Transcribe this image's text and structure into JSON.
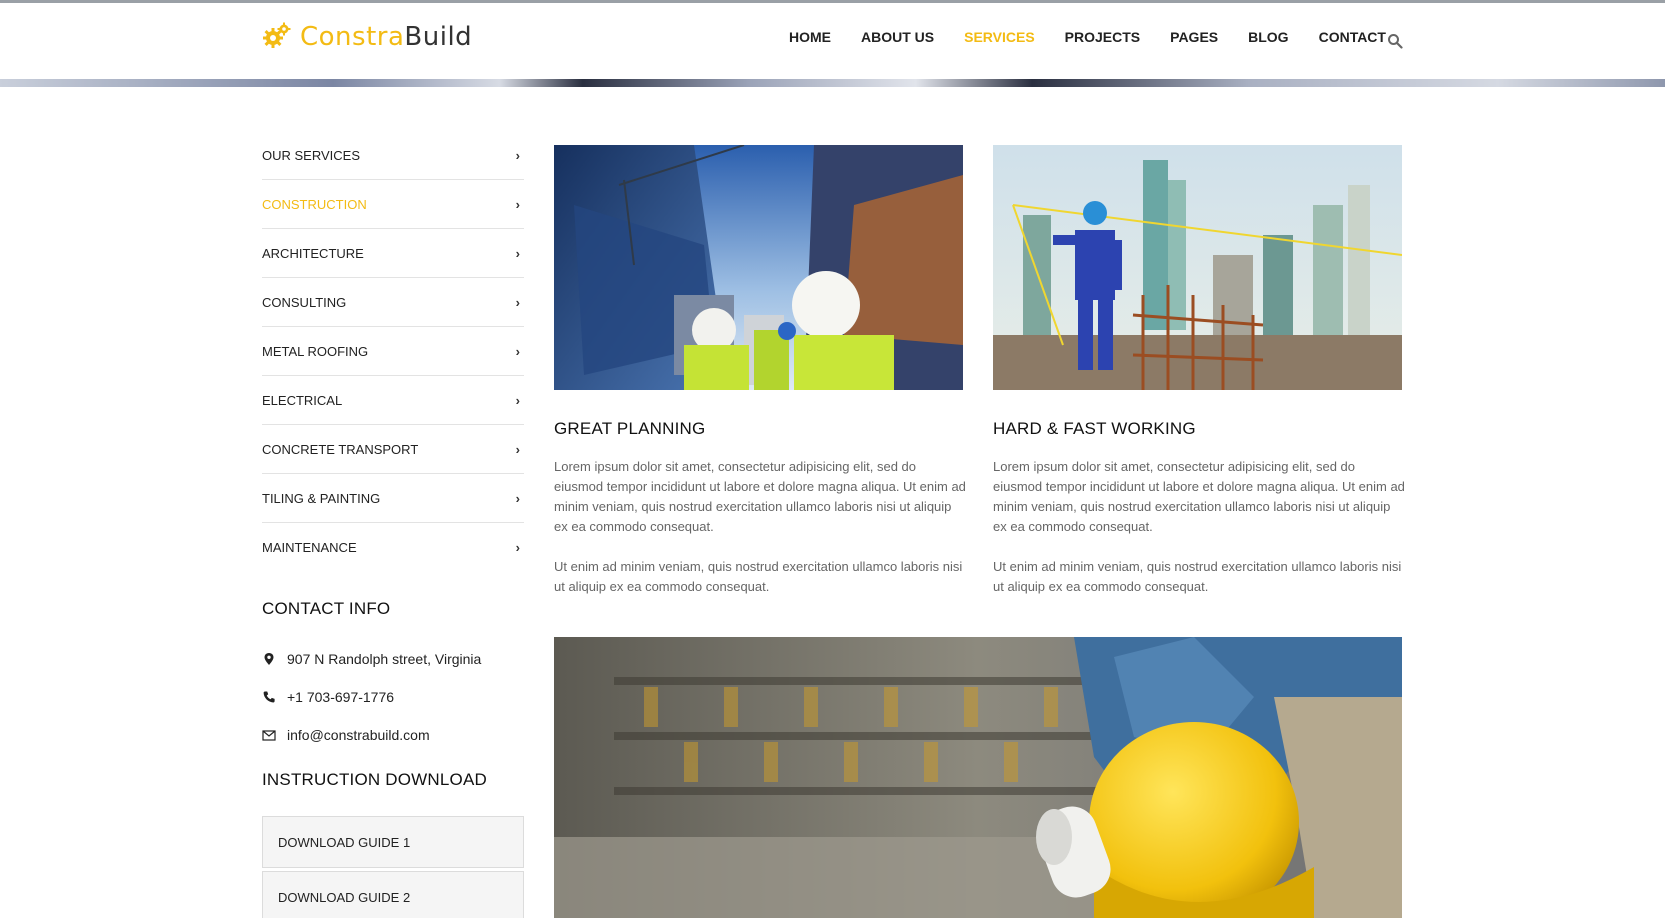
{
  "brand": {
    "name_part1": "Constra",
    "name_part2": "Build",
    "accent_color": "#f3bb14",
    "logo_icon": "gears-icon"
  },
  "nav": {
    "items": [
      {
        "label": "HOME",
        "active": false
      },
      {
        "label": "ABOUT US",
        "active": false
      },
      {
        "label": "SERVICES",
        "active": true
      },
      {
        "label": "PROJECTS",
        "active": false
      },
      {
        "label": "PAGES",
        "active": false
      },
      {
        "label": "BLOG",
        "active": false
      },
      {
        "label": "CONTACT",
        "active": false
      }
    ],
    "search_icon": "search-icon"
  },
  "sidebar": {
    "services": [
      {
        "label": "OUR SERVICES",
        "active": false
      },
      {
        "label": "CONSTRUCTION",
        "active": true
      },
      {
        "label": "ARCHITECTURE",
        "active": false
      },
      {
        "label": "CONSULTING",
        "active": false
      },
      {
        "label": "METAL ROOFING",
        "active": false
      },
      {
        "label": "ELECTRICAL",
        "active": false
      },
      {
        "label": "CONCRETE TRANSPORT",
        "active": false
      },
      {
        "label": "TILING & PAINTING",
        "active": false
      },
      {
        "label": "MAINTENANCE",
        "active": false
      }
    ],
    "contact_heading": "CONTACT INFO",
    "contact": {
      "address": "907 N Randolph street, Virginia",
      "phone": "+1 703-697-1776",
      "email": "info@constrabuild.com"
    },
    "download_heading": "INSTRUCTION DOWNLOAD",
    "downloads": [
      "DOWNLOAD GUIDE 1",
      "DOWNLOAD GUIDE 2"
    ]
  },
  "cards": [
    {
      "title": "GREAT PLANNING",
      "para1": "Lorem ipsum dolor sit amet, consectetur adipisicing elit, sed do eiusmod tempor incididunt ut labore et dolore magna aliqua. Ut enim ad minim veniam, quis nostrud exercitation ullamco laboris nisi ut aliquip ex ea commodo consequat.",
      "para2": "Ut enim ad minim veniam, quis nostrud exercitation ullamco laboris nisi ut aliquip ex ea commodo consequat."
    },
    {
      "title": "HARD & FAST WORKING",
      "para1": "Lorem ipsum dolor sit amet, consectetur adipisicing elit, sed do eiusmod tempor incididunt ut labore et dolore magna aliqua. Ut enim ad minim veniam, quis nostrud exercitation ullamco laboris nisi ut aliquip ex ea commodo consequat.",
      "para2": "Ut enim ad minim veniam, quis nostrud exercitation ullamco laboris nisi ut aliquip ex ea commodo consequat."
    }
  ]
}
